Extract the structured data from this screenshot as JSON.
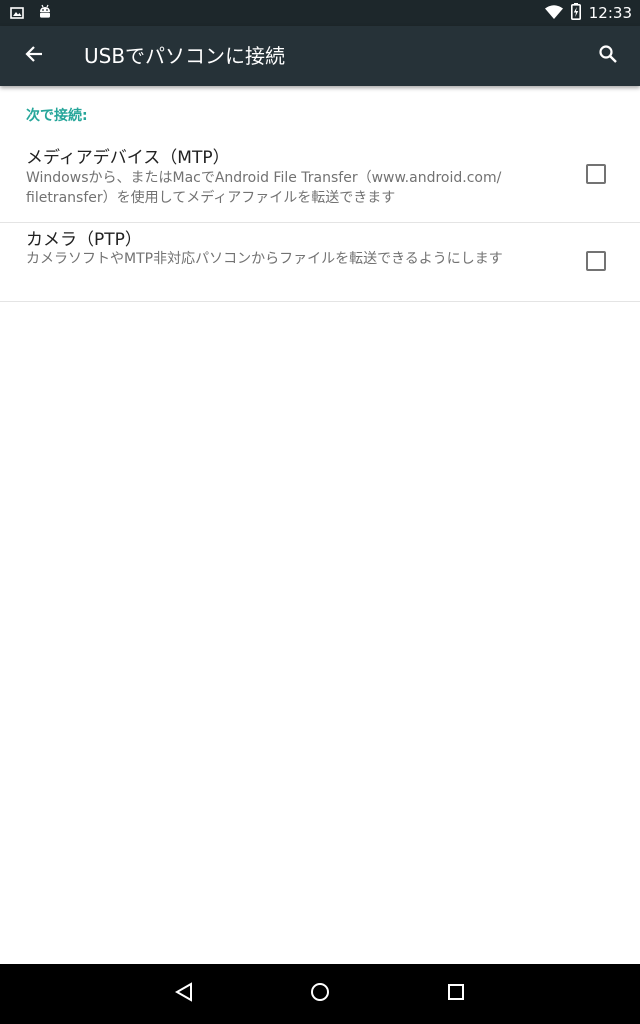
{
  "status_bar": {
    "time": "12:33",
    "icons": [
      "image-notification-icon",
      "android-debug-icon",
      "wifi-icon",
      "battery-charging-icon"
    ]
  },
  "toolbar": {
    "title": "USBでパソコンに接続",
    "back_icon": "arrow-back-icon",
    "search_icon": "search-icon",
    "background": "#263238"
  },
  "section": {
    "header": "次で接続:",
    "accent": "#26a69a"
  },
  "options": [
    {
      "title": "メディアデバイス（MTP）",
      "summary_line1": "Windowsから、またはMacでAndroid File Transfer（www.android.com/",
      "summary_line2": "filetransfer）を使用してメディアファイルを転送できます",
      "checked": false
    },
    {
      "title": "カメラ（PTP）",
      "summary_line1": "カメラソフトやMTP非対応パソコンからファイルを転送できるようにします",
      "checked": false
    }
  ],
  "nav_bar": {
    "buttons": [
      "nav-back-icon",
      "nav-home-icon",
      "nav-recents-icon"
    ]
  }
}
